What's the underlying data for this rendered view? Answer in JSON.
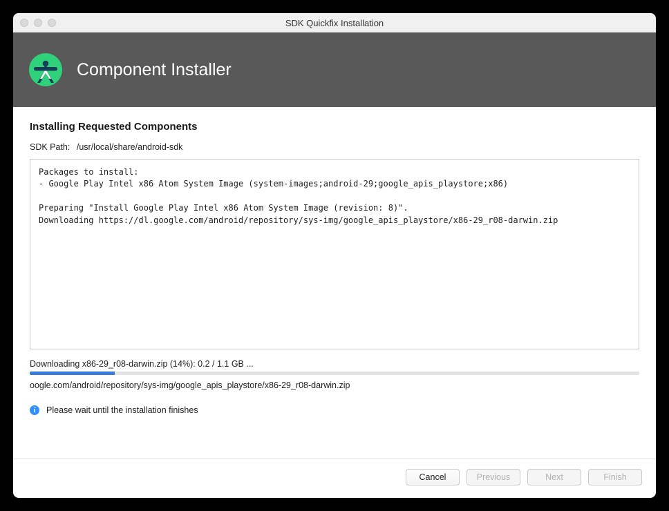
{
  "window": {
    "title": "SDK Quickfix Installation"
  },
  "banner": {
    "title": "Component Installer"
  },
  "content": {
    "heading": "Installing Requested Components",
    "sdk_path_label": "SDK Path:",
    "sdk_path_value": "/usr/local/share/android-sdk",
    "log_text": "Packages to install:\n- Google Play Intel x86 Atom System Image (system-images;android-29;google_apis_playstore;x86)\n\nPreparing \"Install Google Play Intel x86 Atom System Image (revision: 8)\".\nDownloading https://dl.google.com/android/repository/sys-img/google_apis_playstore/x86-29_r08-darwin.zip",
    "download_status": "Downloading x86-29_r08-darwin.zip (14%): 0.2 / 1.1 GB ...",
    "progress_percent": 14,
    "download_path": "oogle.com/android/repository/sys-img/google_apis_playstore/x86-29_r08-darwin.zip",
    "info_message": "Please wait until the installation finishes"
  },
  "footer": {
    "cancel": "Cancel",
    "previous": "Previous",
    "next": "Next",
    "finish": "Finish"
  },
  "icons": {
    "logo": "android-studio-icon",
    "info": "info-icon"
  }
}
